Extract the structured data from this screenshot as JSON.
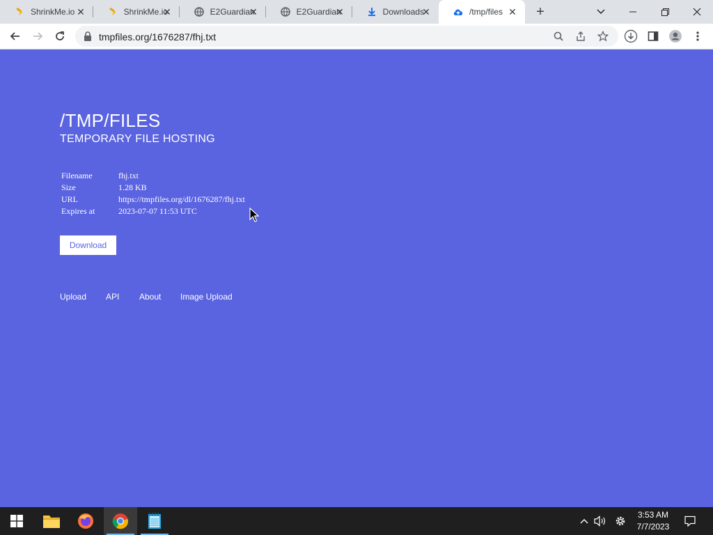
{
  "browser": {
    "tabs": [
      {
        "title": "ShrinkMe.io",
        "icon": "shrinkme-favicon"
      },
      {
        "title": "ShrinkMe.io",
        "icon": "shrinkme-favicon"
      },
      {
        "title": "E2Guardian",
        "icon": "globe-icon"
      },
      {
        "title": "E2Guardian",
        "icon": "globe-icon"
      },
      {
        "title": "Downloads",
        "icon": "download-icon"
      },
      {
        "title": "/tmp/files",
        "icon": "cloud-upload-icon"
      }
    ],
    "active_tab_index": 5,
    "address": "tmpfiles.org/1676287/fhj.txt"
  },
  "page": {
    "title": "/TMP/FILES",
    "subtitle": "TEMPORARY FILE HOSTING",
    "info": {
      "filename_label": "Filename",
      "filename_value": "fhj.txt",
      "size_label": "Size",
      "size_value": "1.28 KB",
      "url_label": "URL",
      "url_value": "https://tmpfiles.org/dl/1676287/fhj.txt",
      "expires_label": "Expires at",
      "expires_value": "2023-07-07 11:53 UTC"
    },
    "download_label": "Download",
    "footer": {
      "upload": "Upload",
      "api": "API",
      "about": "About",
      "image_upload": "Image Upload"
    }
  },
  "taskbar": {
    "time": "3:53 AM",
    "date": "7/7/2023"
  },
  "colors": {
    "page_bg": "#5a63e0",
    "taskbar_bg": "#1f1f1f",
    "tabstrip_bg": "#dee1e6"
  }
}
